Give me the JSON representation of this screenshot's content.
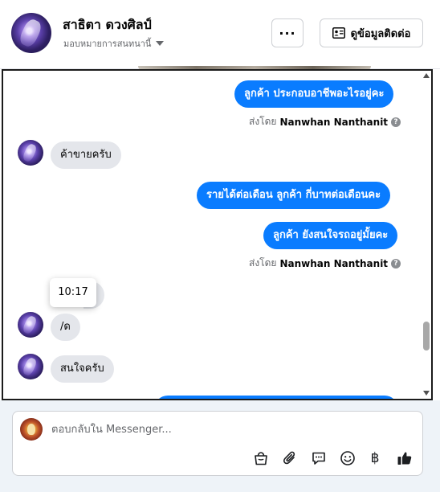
{
  "header": {
    "name": "สาธิตา ดวงศิลป์",
    "assign_label": "มอบหมายการสนทนานี้",
    "more_label": "···",
    "contact_label": "ดูข้อมูลติดต่อ"
  },
  "messages": {
    "m1": "ลูกค้า  ประกอบอาชีพอะไรอยู่คะ",
    "sent1_prefix": "ส่งโดย",
    "sent1_name": "Nanwhan Nanthanit",
    "m2": "ค้าขายครับ",
    "m3": "รายได้ต่อเดือน  ลูกค้า  กี่บาทต่อเดือนคะ",
    "m4": "ลูกค้า  ยังสนใจรถอยู่มั้ยคะ",
    "sent2_prefix": "ส่งโดย",
    "sent2_name": "Nanwhan Nanthanit",
    "tooltip_time": "10:17",
    "m5": "/ด",
    "m6": "สนใจครับ"
  },
  "composer": {
    "placeholder": "ตอบกลับใน Messenger...",
    "tools": [
      "shopping-bag-icon",
      "attachment-icon",
      "saved-reply-icon",
      "emoji-icon",
      "baht-icon",
      "thumbs-up-icon"
    ],
    "baht_symbol": "฿"
  },
  "colors": {
    "outgoing_bubble": "#0a7cff",
    "incoming_bubble": "#e4e6eb",
    "composer_background": "#eef3f8"
  }
}
